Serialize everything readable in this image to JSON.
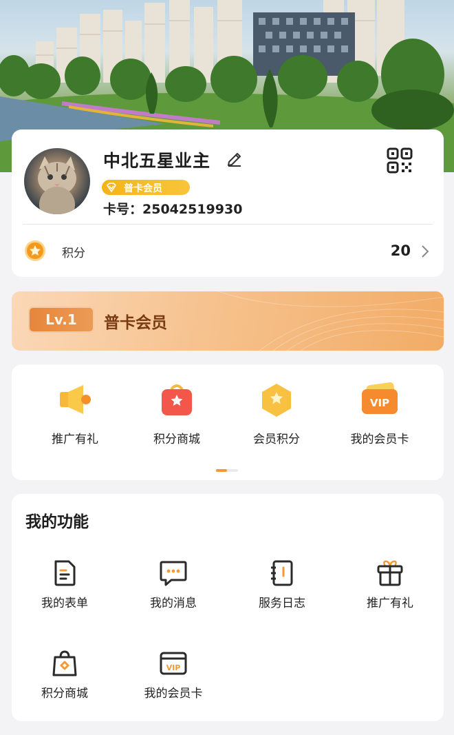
{
  "profile": {
    "username": "中北五星业主",
    "member_badge": "普卡会员",
    "card_number": "卡号：25042519930",
    "points_label": "积分",
    "points_value": "20"
  },
  "level": {
    "tag": "Lv.1",
    "name": "普卡会员"
  },
  "shortcuts": [
    {
      "label": "推广有礼",
      "icon": "megaphone-icon"
    },
    {
      "label": "积分商城",
      "icon": "store-bag-icon"
    },
    {
      "label": "会员积分",
      "icon": "points-hexagon-icon"
    },
    {
      "label": "我的会员卡",
      "icon": "vip-card-icon"
    }
  ],
  "functions": {
    "title": "我的功能",
    "items": [
      {
        "label": "我的表单",
        "icon": "form-icon"
      },
      {
        "label": "我的消息",
        "icon": "message-icon"
      },
      {
        "label": "服务日志",
        "icon": "service-log-icon"
      },
      {
        "label": "推广有礼",
        "icon": "gift-icon"
      },
      {
        "label": "积分商城",
        "icon": "shopping-bag-icon"
      },
      {
        "label": "我的会员卡",
        "icon": "vip-card-outline-icon"
      }
    ]
  },
  "colors": {
    "accent": "#f39a36",
    "badge": "#f4b418",
    "level_text": "#7a3b12"
  }
}
